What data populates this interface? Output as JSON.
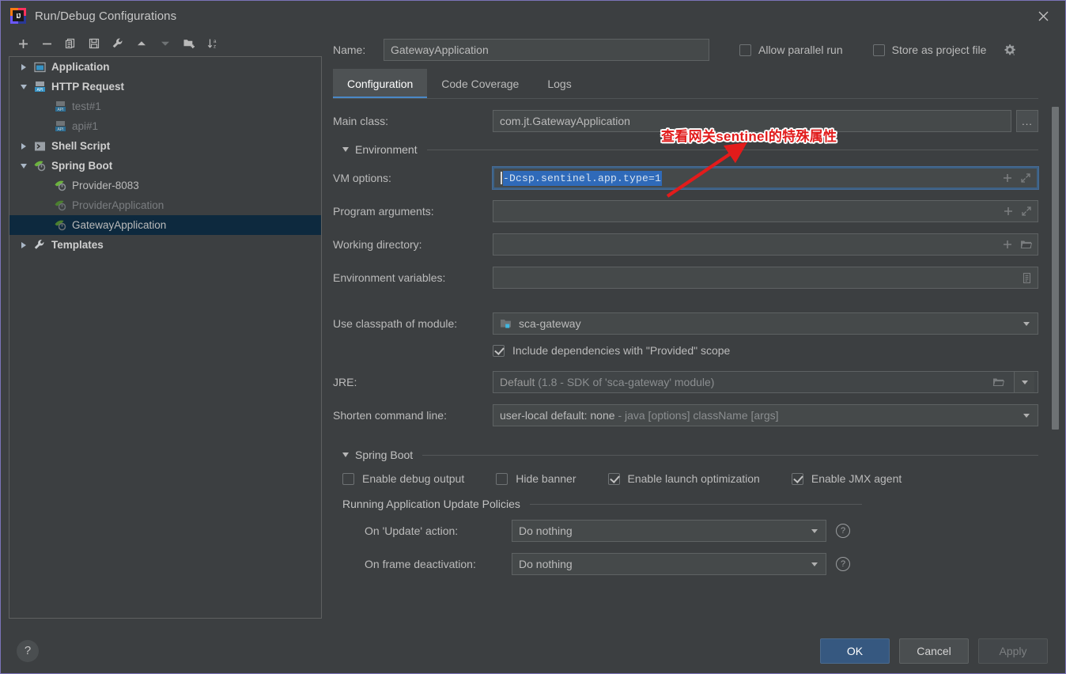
{
  "window": {
    "title": "Run/Debug Configurations",
    "close_label": "close-window",
    "app_logo_text": "IJ"
  },
  "toolbar": {
    "buttons": [
      {
        "name": "add-configuration",
        "icon": "plus-icon",
        "label": "Add New Configuration"
      },
      {
        "name": "remove-configuration",
        "icon": "minus-icon",
        "label": "Remove Configuration"
      },
      {
        "name": "copy-configuration",
        "icon": "copy-icon",
        "label": "Copy Configuration"
      },
      {
        "name": "save-configuration",
        "icon": "save-icon",
        "label": "Save Configuration"
      },
      {
        "name": "edit-templates",
        "icon": "wrench-icon",
        "label": "Edit Templates"
      },
      {
        "name": "move-up",
        "icon": "arrow-up-icon",
        "label": "Move Up"
      },
      {
        "name": "move-down",
        "icon": "arrow-down-icon",
        "label": "Move Down"
      },
      {
        "name": "new-folder",
        "icon": "new-folder-icon",
        "label": "Create New Folder"
      },
      {
        "name": "sort-alphabetically",
        "icon": "sort-az-icon",
        "label": "Sort Configurations"
      }
    ]
  },
  "tree": {
    "items": [
      {
        "label": "Application",
        "indent": 0,
        "expander": "right",
        "icon": "application-icon",
        "style": "bold",
        "selected": false
      },
      {
        "label": "HTTP Request",
        "indent": 0,
        "expander": "down",
        "icon": "http-request-icon",
        "style": "bold",
        "selected": false
      },
      {
        "label": "test#1",
        "indent": 1,
        "expander": "none",
        "icon": "http-request-icon",
        "style": "dim",
        "selected": false
      },
      {
        "label": "api#1",
        "indent": 1,
        "expander": "none",
        "icon": "http-request-icon",
        "style": "dim",
        "selected": false
      },
      {
        "label": "Shell Script",
        "indent": 0,
        "expander": "right",
        "icon": "shell-script-icon",
        "style": "bold",
        "selected": false
      },
      {
        "label": "Spring Boot",
        "indent": 0,
        "expander": "down",
        "icon": "spring-boot-icon",
        "style": "bold",
        "selected": false
      },
      {
        "label": "Provider-8083",
        "indent": 1,
        "expander": "none",
        "icon": "spring-boot-icon",
        "style": "norm",
        "selected": false
      },
      {
        "label": "ProviderApplication",
        "indent": 1,
        "expander": "none",
        "icon": "spring-boot-icon-dim",
        "style": "dim",
        "selected": false
      },
      {
        "label": "GatewayApplication",
        "indent": 1,
        "expander": "none",
        "icon": "spring-boot-icon-dim",
        "style": "norm",
        "selected": true
      },
      {
        "label": "Templates",
        "indent": 0,
        "expander": "right",
        "icon": "wrench-icon",
        "style": "bold",
        "selected": false
      }
    ]
  },
  "header": {
    "name_label": "Name:",
    "name_value": "GatewayApplication",
    "name_placeholder": "",
    "allow_parallel_run": {
      "label": "Allow parallel run",
      "checked": false
    },
    "store_as_project_file": {
      "label": "Store as project file",
      "checked": false
    },
    "gear_icon": "gear-dropdown-icon"
  },
  "tabs": {
    "items": [
      {
        "label": "Configuration",
        "active": true
      },
      {
        "label": "Code Coverage",
        "active": false
      },
      {
        "label": "Logs",
        "active": false
      }
    ]
  },
  "form": {
    "main_class": {
      "label": "Main class:",
      "value": "com.jt.GatewayApplication",
      "browse_label": "..."
    },
    "environment_section": {
      "label": "Environment",
      "expanded": true
    },
    "vm_options": {
      "label": "VM options:",
      "value": "-Dcsp.sentinel.app.type=1",
      "selected": true,
      "focused": true
    },
    "program_arguments": {
      "label": "Program arguments:",
      "value": ""
    },
    "working_directory": {
      "label": "Working directory:",
      "value": ""
    },
    "environment_variables": {
      "label": "Environment variables:",
      "value": ""
    },
    "use_classpath_of_module": {
      "label": "Use classpath of module:",
      "value": "sca-gateway"
    },
    "include_provided_scope": {
      "label": "Include dependencies with \"Provided\" scope",
      "checked": true
    },
    "jre": {
      "label": "JRE:",
      "value_bold": "Default",
      "value_muted": "(1.8 - SDK of 'sca-gateway' module)"
    },
    "shorten_command_line": {
      "label": "Shorten command line:",
      "value_bold": "user-local default: none",
      "value_muted": "- java [options] className [args]"
    },
    "spring_boot_section": {
      "label": "Spring Boot",
      "expanded": true
    },
    "spring_boot_checks": [
      {
        "label": "Enable debug output",
        "checked": false
      },
      {
        "label": "Hide banner",
        "checked": false
      },
      {
        "label": "Enable launch optimization",
        "checked": true
      },
      {
        "label": "Enable JMX agent",
        "checked": true
      }
    ],
    "update_policies_section": {
      "label": "Running Application Update Policies"
    },
    "on_update_action": {
      "label": "On 'Update' action:",
      "value": "Do nothing"
    },
    "on_frame_deactivation": {
      "label": "On frame deactivation:",
      "value": "Do nothing"
    }
  },
  "footer": {
    "help_label": "?",
    "ok_label": "OK",
    "cancel_label": "Cancel",
    "apply_label": "Apply",
    "apply_enabled": false
  },
  "annotation": {
    "text": "查看网关sentinel的特殊属性",
    "color": "#e11b1b",
    "arrow": "red-arrow-pointing-up-right"
  },
  "colors": {
    "window_bg": "#3c3f41",
    "field_bg": "#45494a",
    "border": "#5e6263",
    "accent": "#4a88c7",
    "selection": "#2f6ab9",
    "tree_selected": "#0d293e",
    "primary_button": "#365880",
    "text": "#bbbbbb",
    "annotation_red": "#e11b1b"
  }
}
